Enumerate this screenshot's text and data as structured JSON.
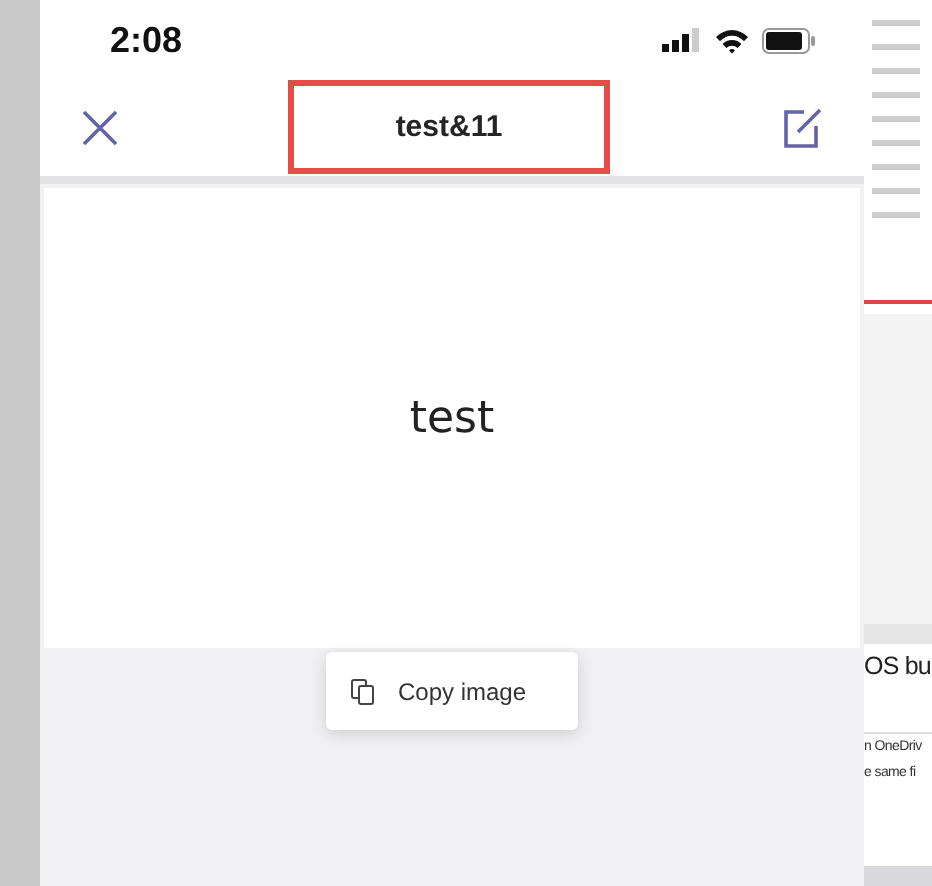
{
  "status_bar": {
    "time": "2:08"
  },
  "header": {
    "title": "test&11",
    "title_highlighted": true
  },
  "image": {
    "text": "test"
  },
  "context_menu": {
    "items": [
      {
        "label": "Copy image"
      }
    ]
  },
  "background_page": {
    "heading": "OS bu",
    "lines": [
      "n OneDriv",
      "e same fi"
    ]
  }
}
